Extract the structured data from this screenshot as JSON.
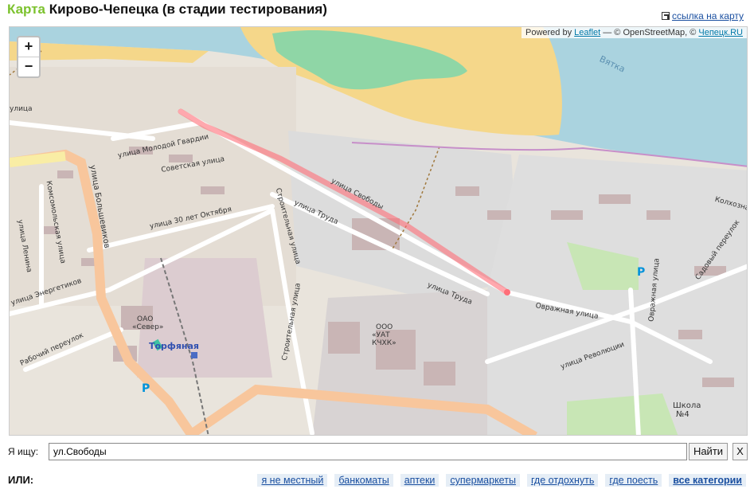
{
  "header": {
    "brand": "Карта",
    "title": "Кирово-Чепецка (в стадии тестирования)",
    "map_link": "ссылка на карту"
  },
  "map": {
    "zoom_in": "+",
    "zoom_out": "−",
    "attribution": {
      "powered": "Powered by",
      "leaflet": "Leaflet",
      "osm": "— © OpenStreetMap, ©",
      "site": "Чепецк.RU"
    },
    "labels": {
      "river": "Вятка",
      "svobody": "улица Свободы",
      "trudy1": "улица Труда",
      "trudy2": "улица Труда",
      "molodoy": "улица Молодой Гвардии",
      "sovetskaya": "Советская улица",
      "oct": "улица 30 лет Октября",
      "bolshevikov": "улица Большевиков",
      "komsom": "Комсомольская улица",
      "lenina": "улица Ленина",
      "energet": "улица Энергетиков",
      "rabochiy": "Рабочий переулок",
      "stroit1": "Строительная улица",
      "stroit2": "Строительная улица",
      "ovrazhnaya1": "Овражная улица",
      "ovrazhnaya2": "Овражная улица",
      "revolyucii": "улица Революции",
      "kolhoz": "Колхозная",
      "sadovyy": "Садовый переулок",
      "sever1": "ОАО",
      "sever2": "«Север»",
      "uat1": "ООО",
      "uat2": "«УАТ",
      "uat3": "КЧХК»",
      "torf": "Торфяная",
      "shkola1": "Школа",
      "shkola2": "№4",
      "ulica": "улица",
      "parking": "P"
    }
  },
  "search": {
    "label": "Я ищу:",
    "value": "ул.Свободы",
    "find": "Найти",
    "clear": "X"
  },
  "categories": {
    "or_label": "ИЛИ:",
    "items": [
      "я не местный",
      "банкоматы",
      "аптеки",
      "супермаркеты",
      "где отдохнуть",
      "где поесть",
      "все категории"
    ]
  }
}
